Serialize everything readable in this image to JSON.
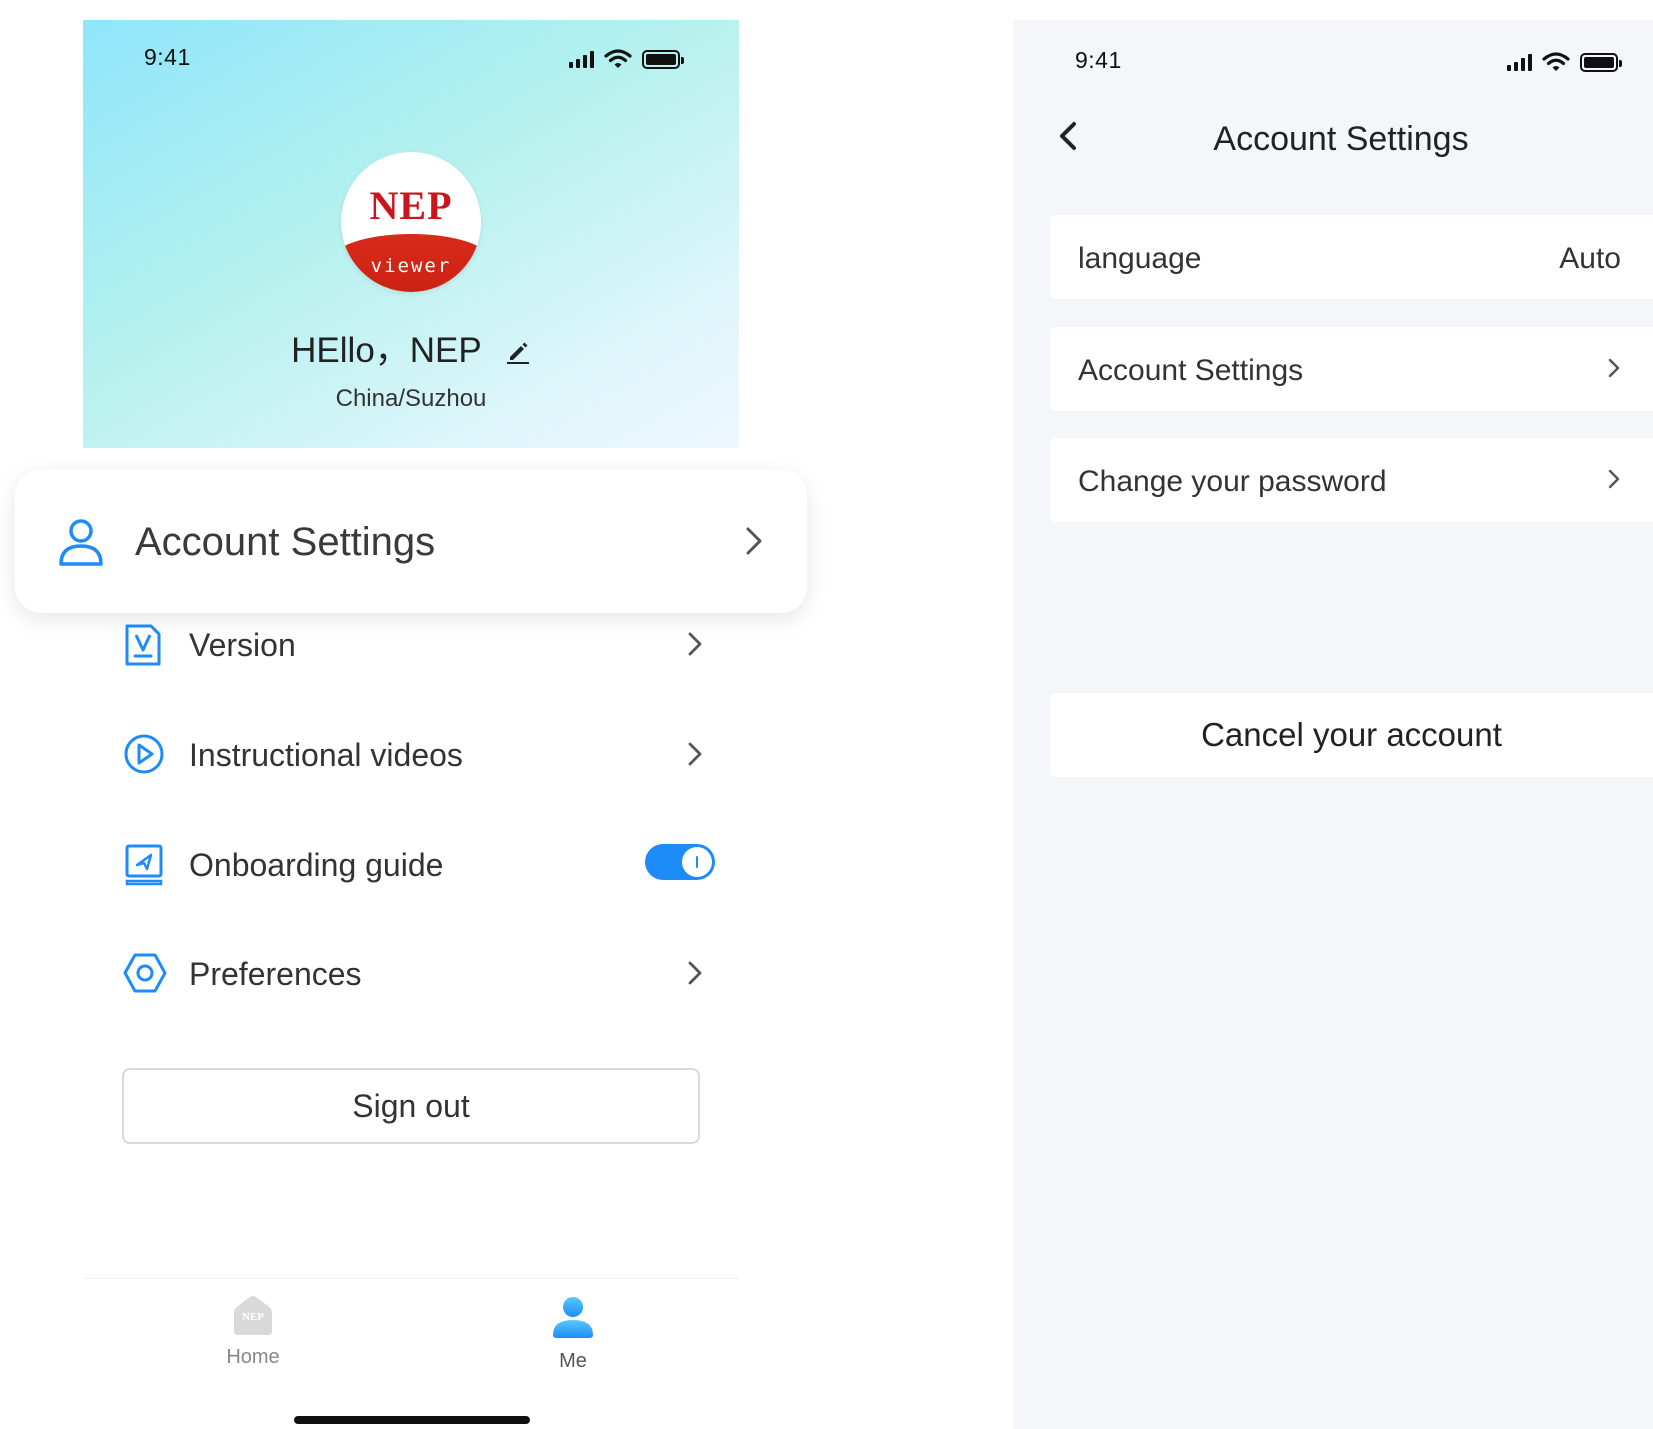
{
  "colors": {
    "accent": "#1d8cf8",
    "header_gradient_start": "#8fe6fb",
    "header_gradient_end": "#eef8fe",
    "logo_red": "#c8161d",
    "settings_background": "#f5f6f9"
  },
  "left_screen": {
    "status_bar": {
      "time": "9:41",
      "icons": [
        "signal-icon",
        "wifi-icon",
        "battery-icon"
      ]
    },
    "profile": {
      "logo_text": "NEP",
      "logo_subtext": "viewer",
      "greeting": "HEllo，NEP",
      "location": "China/Suzhou",
      "edit_icon": "pencil-icon"
    },
    "highlighted_item": {
      "label": "Account Settings",
      "icon": "user-icon"
    },
    "menu": {
      "items": [
        {
          "label": "Version",
          "icon": "version-icon",
          "control": "chevron"
        },
        {
          "label": "Instructional videos",
          "icon": "play-circle-icon",
          "control": "chevron"
        },
        {
          "label": "Onboarding guide",
          "icon": "guide-book-icon",
          "control": "toggle",
          "toggle_on": true
        },
        {
          "label": "Preferences",
          "icon": "hexagon-settings-icon",
          "control": "chevron"
        }
      ]
    },
    "sign_out_label": "Sign out",
    "tab_bar": {
      "items": [
        {
          "label": "Home",
          "icon": "home-icon",
          "icon_text": "NEP",
          "active": false
        },
        {
          "label": "Me",
          "icon": "person-icon",
          "active": true
        }
      ]
    }
  },
  "right_screen": {
    "status_bar": {
      "time": "9:41",
      "icons": [
        "signal-icon",
        "wifi-icon",
        "battery-icon"
      ]
    },
    "nav": {
      "title": "Account Settings",
      "back_icon": "back-arrow-icon"
    },
    "rows": [
      {
        "label": "language",
        "value": "Auto"
      },
      {
        "label": "Account Settings",
        "value": ""
      },
      {
        "label": "Change your password",
        "value": ""
      }
    ],
    "cancel_button_label": "Cancel your account"
  }
}
